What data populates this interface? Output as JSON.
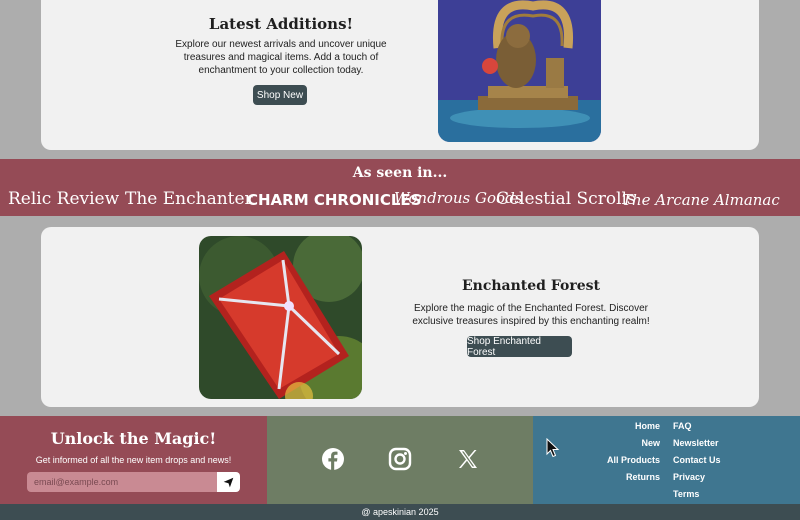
{
  "latest": {
    "title": "Latest Additions!",
    "description": "Explore our newest arrivals and uncover unique treasures and magical items. Add a touch of enchantment to your collection today.",
    "button": "Shop New"
  },
  "seen_in": {
    "title": "As seen in...",
    "brands": [
      "Relic Review",
      "The Enchanter",
      "CHARM CHRONICLES",
      "Wondrous Goods",
      "Celestial Scrolls",
      "The Arcane Almanac"
    ]
  },
  "forest": {
    "title": "Enchanted Forest",
    "description": "Explore the magic of the Enchanted Forest. Discover exclusive treasures inspired by this enchanting realm!",
    "button": "Shop Enchanted Forest"
  },
  "newsletter": {
    "title": "Unlock the Magic!",
    "description": "Get informed of all the new item drops and news!",
    "placeholder": "email@example.com"
  },
  "social": [
    "facebook-icon",
    "instagram-icon",
    "x-icon"
  ],
  "links": {
    "left": [
      "Home",
      "New",
      "All Products",
      "Returns"
    ],
    "right": [
      "FAQ",
      "Newsletter",
      "Contact Us",
      "Privacy",
      "Terms"
    ]
  },
  "footer": {
    "copyright": "@ apeskinian 2025"
  },
  "colors": {
    "banner": "#954b56",
    "social_panel": "#6e7d64",
    "links_panel": "#3f7690",
    "button": "#3d4d52"
  }
}
